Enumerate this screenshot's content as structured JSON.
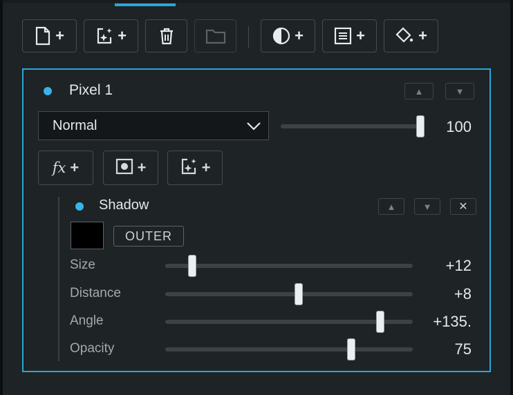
{
  "toolbar": {
    "buttons": [
      {
        "name": "new-layer",
        "icon": "new-file-icon",
        "plus": "+"
      },
      {
        "name": "new-adjustment",
        "icon": "sparkle-frame-icon",
        "plus": "+"
      },
      {
        "name": "delete",
        "icon": "trash-icon"
      },
      {
        "name": "group",
        "icon": "folder-icon",
        "disabled": true
      },
      {
        "name": "contrast",
        "icon": "half-circle-icon",
        "plus": "+"
      },
      {
        "name": "add-layer-content",
        "icon": "text-frame-icon",
        "plus": "+"
      },
      {
        "name": "fill",
        "icon": "paint-bucket-icon",
        "plus": "+"
      }
    ]
  },
  "layer": {
    "name": "Pixel 1",
    "dot_color": "#37b4e8",
    "move_up": "▲",
    "move_down": "▼",
    "blend_mode": "Normal",
    "opacity_value": "100",
    "opacity_fraction": 0.97,
    "add_fx_label": "fx",
    "plus": "+"
  },
  "effect": {
    "name": "Shadow",
    "move_up": "▲",
    "move_down": "▼",
    "close": "✕",
    "color": "#000000",
    "mode": "OUTER",
    "params": [
      {
        "label": "Size",
        "value": "+12",
        "fraction": 0.11
      },
      {
        "label": "Distance",
        "value": "+8",
        "fraction": 0.54
      },
      {
        "label": "Angle",
        "value": "+135.",
        "fraction": 0.87
      },
      {
        "label": "Opacity",
        "value": "75",
        "fraction": 0.75
      }
    ]
  },
  "colors": {
    "accent": "#2aa8d8"
  }
}
